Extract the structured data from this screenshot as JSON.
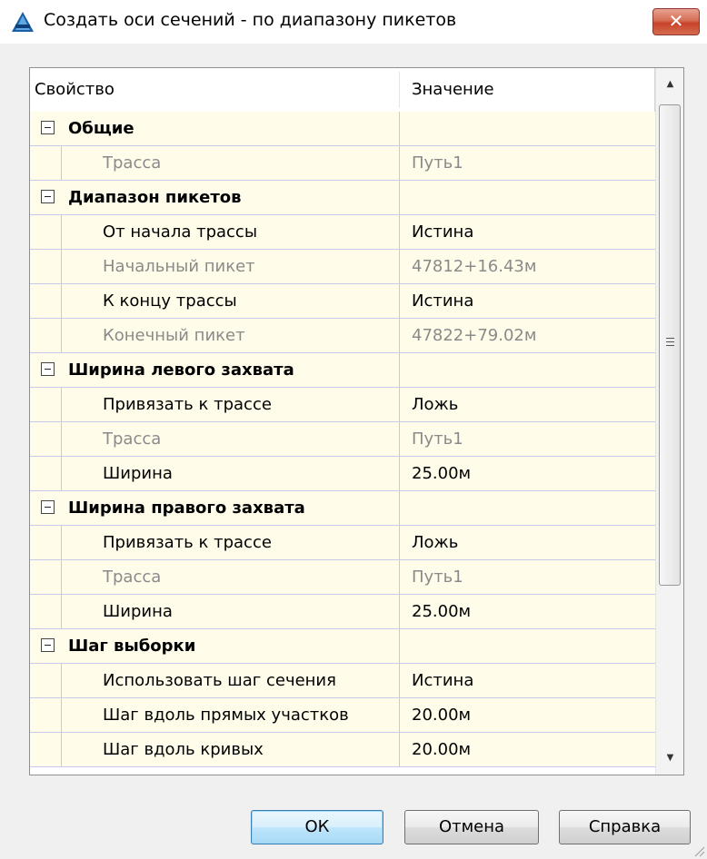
{
  "window": {
    "title": "Создать оси сечений - по диапазону пикетов",
    "close_label": "✕"
  },
  "grid": {
    "header": {
      "property": "Свойство",
      "value": "Значение"
    },
    "rows": [
      {
        "type": "category",
        "label": "Общие"
      },
      {
        "type": "property",
        "label": "Трасса",
        "value": "Путь1",
        "disabled": true
      },
      {
        "type": "category",
        "label": "Диапазон пикетов"
      },
      {
        "type": "property",
        "label": "От начала трассы",
        "value": "Истина",
        "disabled": false
      },
      {
        "type": "property",
        "label": "Начальный пикет",
        "value": "47812+16.43м",
        "disabled": true
      },
      {
        "type": "property",
        "label": "К концу трассы",
        "value": "Истина",
        "disabled": false
      },
      {
        "type": "property",
        "label": "Конечный пикет",
        "value": "47822+79.02м",
        "disabled": true
      },
      {
        "type": "category",
        "label": "Ширина левого захвата"
      },
      {
        "type": "property",
        "label": "Привязать к трассе",
        "value": "Ложь",
        "disabled": false
      },
      {
        "type": "property",
        "label": "Трасса",
        "value": "Путь1",
        "disabled": true
      },
      {
        "type": "property",
        "label": "Ширина",
        "value": "25.00м",
        "disabled": false
      },
      {
        "type": "category",
        "label": "Ширина правого захвата"
      },
      {
        "type": "property",
        "label": "Привязать к трассе",
        "value": "Ложь",
        "disabled": false
      },
      {
        "type": "property",
        "label": "Трасса",
        "value": "Путь1",
        "disabled": true
      },
      {
        "type": "property",
        "label": "Ширина",
        "value": "25.00м",
        "disabled": false
      },
      {
        "type": "category",
        "label": "Шаг выборки"
      },
      {
        "type": "property",
        "label": "Использовать шаг сечения",
        "value": "Истина",
        "disabled": false
      },
      {
        "type": "property",
        "label": "Шаг вдоль прямых участков",
        "value": "20.00м",
        "disabled": false
      },
      {
        "type": "property",
        "label": "Шаг вдоль кривых",
        "value": "20.00м",
        "disabled": false
      }
    ]
  },
  "buttons": {
    "ok": "ОК",
    "cancel": "Отмена",
    "help": "Справка"
  },
  "colors": {
    "row_background": "#fffdea",
    "close_button": "#c7432a",
    "default_button_border": "#3c7fb1"
  }
}
